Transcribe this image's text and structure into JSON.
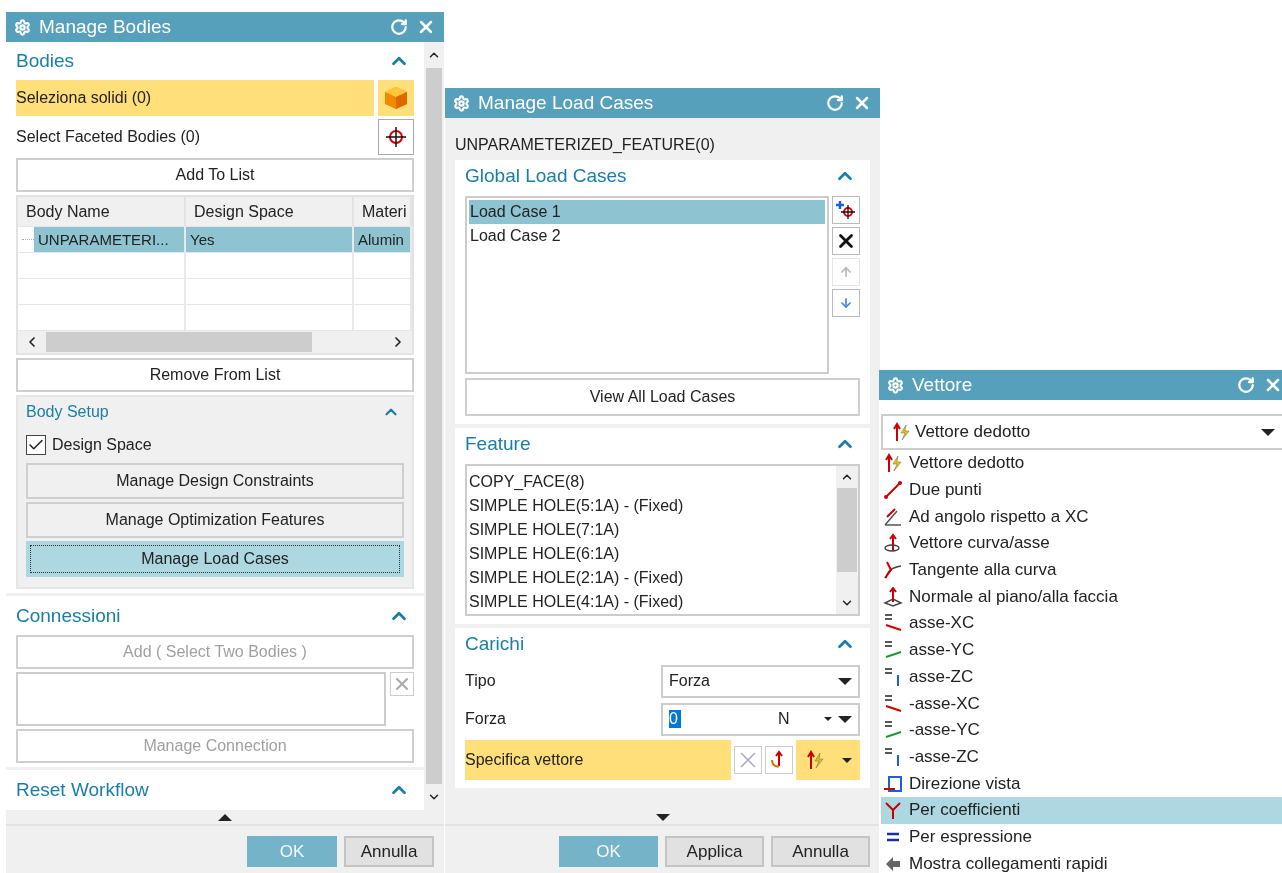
{
  "manage_bodies": {
    "title": "Manage Bodies",
    "bodies": {
      "title": "Bodies",
      "expanded": true,
      "selections": [
        {
          "label": "Seleziona solidi (0)",
          "active": true,
          "kind": "solid"
        },
        {
          "label": "Select Faceted Bodies (0)",
          "active": false,
          "kind": "crosshair"
        }
      ],
      "add_button": "Add To List",
      "table": {
        "columns": [
          "Body Name",
          "Design Space",
          "Materi"
        ],
        "rows": [
          {
            "cells": [
              "UNPARAMETERI...",
              "Yes",
              "Alumin"
            ],
            "selected": true
          }
        ]
      },
      "remove_button": "Remove From List",
      "body_setup": {
        "title": "Body Setup",
        "expanded": true,
        "checkbox": {
          "label": "Design Space",
          "checked": true
        },
        "buttons": [
          {
            "label": "Manage Design Constraints",
            "focused": false
          },
          {
            "label": "Manage Optimization Features",
            "focused": false
          },
          {
            "label": "Manage Load Cases",
            "focused": true
          }
        ]
      }
    },
    "connections": {
      "title": "Connessioni",
      "expanded": true,
      "add_button": {
        "label": "Add  ( Select Two Bodies )",
        "disabled": true
      },
      "manage_button": {
        "label": "Manage Connection",
        "disabled": true
      }
    },
    "reset_workflow": {
      "title": "Reset Workflow",
      "expanded": true
    },
    "buttons": [
      {
        "label": "OK",
        "kind": "primary"
      },
      {
        "label": "Annulla",
        "kind": "normal"
      }
    ]
  },
  "manage_load_cases": {
    "title": "Manage Load Cases",
    "feature_label": "UNPARAMETERIZED_FEATURE(0)",
    "global_load_cases": {
      "title": "Global Load Cases",
      "expanded": true,
      "items": [
        {
          "label": "Load Case 1",
          "selected": true
        },
        {
          "label": "Load Case 2",
          "selected": false
        }
      ],
      "side_buttons": [
        {
          "kind": "add",
          "disabled": false
        },
        {
          "kind": "delete",
          "disabled": false
        },
        {
          "kind": "up",
          "disabled": true
        },
        {
          "kind": "down",
          "disabled": false
        }
      ],
      "view_all_button": "View All Load Cases"
    },
    "feature": {
      "title": "Feature",
      "expanded": true,
      "items": [
        "COPY_FACE(8)",
        "SIMPLE HOLE(5:1A) - (Fixed)",
        "SIMPLE HOLE(7:1A)",
        "SIMPLE HOLE(6:1A)",
        "SIMPLE HOLE(2:1A) - (Fixed)",
        "SIMPLE HOLE(4:1A) - (Fixed)"
      ]
    },
    "carichi": {
      "title": "Carichi",
      "expanded": true,
      "tipo": {
        "label": "Tipo",
        "value": "Forza"
      },
      "forza": {
        "label": "Forza",
        "value": "0",
        "unit": "N"
      },
      "vector": {
        "label": "Specifica vettore",
        "active": true
      }
    },
    "buttons": [
      {
        "label": "OK",
        "kind": "primary"
      },
      {
        "label": "Applica",
        "kind": "normal"
      },
      {
        "label": "Annulla",
        "kind": "normal"
      }
    ]
  },
  "vettore": {
    "title": "Vettore",
    "dropdown": {
      "value": "Vettore dedotto",
      "kind": "inferred"
    },
    "options": [
      {
        "label": "Vettore dedotto",
        "kind": "inferred",
        "selected": false
      },
      {
        "label": "Due punti",
        "kind": "two-points",
        "selected": false
      },
      {
        "label": "Ad angolo rispetto a XC",
        "kind": "angle",
        "selected": false
      },
      {
        "label": "Vettore curva/asse",
        "kind": "curve-axis",
        "selected": false
      },
      {
        "label": "Tangente alla curva",
        "kind": "tangent",
        "selected": false
      },
      {
        "label": "Normale al piano/alla faccia",
        "kind": "normal",
        "selected": false
      },
      {
        "label": "asse-XC",
        "kind": "axis-x",
        "selected": false
      },
      {
        "label": "asse-YC",
        "kind": "axis-y",
        "selected": false
      },
      {
        "label": "asse-ZC",
        "kind": "axis-z",
        "selected": false
      },
      {
        "label": "-asse-XC",
        "kind": "neg-x",
        "selected": false
      },
      {
        "label": "-asse-YC",
        "kind": "neg-y",
        "selected": false
      },
      {
        "label": "-asse-ZC",
        "kind": "neg-z",
        "selected": false
      },
      {
        "label": "Direzione vista",
        "kind": "view",
        "selected": false
      },
      {
        "label": "Per coefficienti",
        "kind": "coefficients",
        "selected": true
      },
      {
        "label": "Per espressione",
        "kind": "expression",
        "selected": false
      },
      {
        "label": "Mostra collegamenti rapidi",
        "kind": "shortcuts",
        "selected": false
      }
    ]
  }
}
